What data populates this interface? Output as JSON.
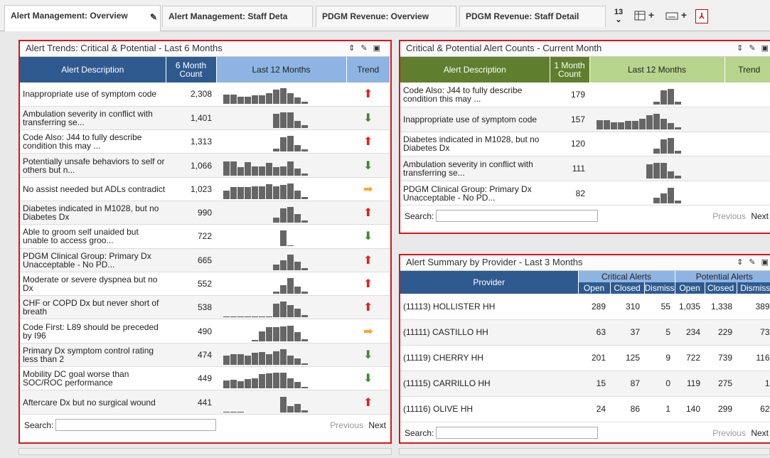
{
  "tabs": [
    {
      "label": "Alert Management: Overview",
      "active": true
    },
    {
      "label": "Alert Management: Staff Deta",
      "active": false
    },
    {
      "label": "PDGM Revenue: Overview",
      "active": false
    },
    {
      "label": "PDGM Revenue: Staff Detail",
      "active": false
    }
  ],
  "tab_count": "13",
  "tab_count_arrow": "⌄",
  "add_plus_1": "+",
  "add_plus_2": "+",
  "trends": {
    "title": "Alert Trends: Critical & Potential - Last 6 Months",
    "col_desc": "Alert Description",
    "col_count": "6 Month Count",
    "col_months": "Last 12 Months",
    "col_trend": "Trend",
    "rows": [
      {
        "desc": "Inappropriate use of symptom code",
        "count": "2,308",
        "trend": "up",
        "spark": [
          0.6,
          0.6,
          0.45,
          0.45,
          0.55,
          0.55,
          0.7,
          0.9,
          1.0,
          0.7,
          0.4,
          0.15
        ]
      },
      {
        "desc": "Ambulation severity in conflict with transferring se...",
        "count": "1,401",
        "trend": "down",
        "spark": [
          0,
          0,
          0,
          0,
          0,
          0,
          0,
          0.9,
          1.0,
          1.0,
          0.45,
          0.2
        ]
      },
      {
        "desc": "Code Also: J44 to fully describe condition this may ...",
        "count": "1,313",
        "trend": "up",
        "spark": [
          0,
          0,
          0,
          0,
          0,
          0,
          0,
          0.2,
          0.9,
          1.0,
          0.4,
          0.15
        ]
      },
      {
        "desc": "Potentially unsafe behaviors to self or others but n...",
        "count": "1,066",
        "trend": "down",
        "spark": [
          0.9,
          0.9,
          0.55,
          0.85,
          0.6,
          0.6,
          0.8,
          0.55,
          0.6,
          0.9,
          0.45,
          0.15
        ]
      },
      {
        "desc": "No assist needed but ADLs contradict",
        "count": "1,023",
        "trend": "side",
        "spark": [
          0.55,
          0.75,
          0.75,
          0.75,
          0.8,
          0.8,
          0.95,
          0.8,
          0.9,
          1.0,
          0.55,
          0.15
        ]
      },
      {
        "desc": "Diabetes indicated in M1028, but no Diabetes Dx",
        "count": "990",
        "trend": "up",
        "spark": [
          0,
          0,
          0,
          0,
          0,
          0,
          0,
          0.3,
          0.9,
          1.0,
          0.55,
          0.15
        ]
      },
      {
        "desc": "Able to groom self unaided but unable to access groo...",
        "count": "722",
        "trend": "down",
        "spark": [
          0,
          0,
          0,
          0,
          0,
          0,
          0,
          0,
          1.0,
          0.04,
          0,
          0
        ]
      },
      {
        "desc": "PDGM Clinical Group: Primary Dx Unacceptable - No PD...",
        "count": "665",
        "trend": "up",
        "spark": [
          0,
          0,
          0,
          0,
          0,
          0,
          0,
          0.35,
          0.65,
          1.0,
          0.55,
          0.15
        ]
      },
      {
        "desc": "Moderate or severe dyspnea but no Dx",
        "count": "552",
        "trend": "up",
        "spark": [
          0,
          0,
          0,
          0,
          0,
          0,
          0,
          0.15,
          0.55,
          1.0,
          0.45,
          0.15
        ]
      },
      {
        "desc": "CHF or COPD Dx but never short of breath",
        "count": "538",
        "trend": "up",
        "spark": [
          "l",
          "l",
          "l",
          "l",
          "l",
          "l",
          "l",
          0.85,
          1.0,
          0.75,
          0.55,
          0.15
        ]
      },
      {
        "desc": "Code First: L89 should be preceded by I96",
        "count": "490",
        "trend": "side",
        "spark": [
          0,
          0,
          0,
          0,
          0.1,
          0.65,
          0.9,
          0.9,
          0.95,
          1.0,
          0.6,
          0.15
        ]
      },
      {
        "desc": "Primary Dx symptom control rating less than 2",
        "count": "474",
        "trend": "down",
        "spark": [
          0.6,
          0.7,
          0.7,
          0.6,
          0.75,
          0.8,
          0.7,
          0.85,
          1.0,
          0.6,
          0.4,
          0.1
        ]
      },
      {
        "desc": "Mobility DC goal worse than SOC/ROC performance",
        "count": "449",
        "trend": "down",
        "spark": [
          0.5,
          0.55,
          0.45,
          0.6,
          0.65,
          0.9,
          0.95,
          1.0,
          1.0,
          0.65,
          0.4,
          0.1
        ]
      },
      {
        "desc": "Aftercare Dx but no surgical wound",
        "count": "441",
        "trend": "up",
        "spark": [
          "l",
          "l",
          "l",
          0,
          0,
          0,
          0,
          0,
          1.0,
          0.4,
          0.55,
          0.15
        ]
      }
    ],
    "search_label": "Search:",
    "prev": "Previous",
    "next": "Next"
  },
  "counts": {
    "title": "Critical & Potential Alert Counts - Current Month",
    "col_desc": "Alert Description",
    "col_count": "1 Month Count",
    "col_months": "Last 12 Months",
    "col_trend": "Trend",
    "rows": [
      {
        "desc": "Code Also: J44 to fully describe condition this may ...",
        "count": "179",
        "spark": [
          0,
          0,
          0,
          0,
          0,
          0,
          0,
          0,
          0.2,
          0.9,
          1.0,
          0.2
        ]
      },
      {
        "desc": "Inappropriate use of symptom code",
        "count": "157",
        "spark": [
          0.6,
          0.6,
          0.45,
          0.45,
          0.55,
          0.55,
          0.7,
          0.9,
          1.0,
          0.7,
          0.4,
          0.15
        ]
      },
      {
        "desc": "Diabetes indicated in M1028, but no Diabetes Dx",
        "count": "120",
        "spark": [
          0,
          0,
          0,
          0,
          0,
          0,
          0,
          0,
          0.3,
          0.9,
          1.0,
          0.2
        ]
      },
      {
        "desc": "Ambulation severity in conflict with transferring se...",
        "count": "111",
        "spark": [
          0,
          0,
          0,
          0,
          0,
          0,
          0,
          0.9,
          1.0,
          1.0,
          0.45,
          0.2
        ]
      },
      {
        "desc": "PDGM Clinical Group: Primary Dx Unacceptable - No PD...",
        "count": "82",
        "spark": [
          0,
          0,
          0,
          0,
          0,
          0,
          0,
          0,
          0.35,
          0.65,
          1.0,
          0.2
        ]
      }
    ],
    "search_label": "Search:",
    "prev": "Previous",
    "next": "Next"
  },
  "providers": {
    "title": "Alert Summary by Provider - Last 3 Months",
    "col_provider": "Provider",
    "group_critical": "Critical Alerts",
    "group_potential": "Potential Alerts",
    "sub_open": "Open",
    "sub_closed": "Closed",
    "sub_dismiss": "Dismiss",
    "sub_dismiss2": "Dismiss",
    "rows": [
      {
        "name": "(11113) HOLLISTER HH",
        "c_open": "289",
        "c_closed": "310",
        "c_dismiss": "55",
        "p_open": "1,035",
        "p_closed": "1,338",
        "p_dismiss": "389"
      },
      {
        "name": "(11111) CASTILLO HH",
        "c_open": "63",
        "c_closed": "37",
        "c_dismiss": "5",
        "p_open": "234",
        "p_closed": "229",
        "p_dismiss": "73"
      },
      {
        "name": "(11119) CHERRY HH",
        "c_open": "201",
        "c_closed": "125",
        "c_dismiss": "9",
        "p_open": "722",
        "p_closed": "739",
        "p_dismiss": "116"
      },
      {
        "name": "(11115) CARRILLO HH",
        "c_open": "15",
        "c_closed": "87",
        "c_dismiss": "0",
        "p_open": "119",
        "p_closed": "275",
        "p_dismiss": "1"
      },
      {
        "name": "(11116) OLIVE HH",
        "c_open": "24",
        "c_closed": "86",
        "c_dismiss": "1",
        "p_open": "140",
        "p_closed": "299",
        "p_dismiss": "62"
      }
    ],
    "search_label": "Search:",
    "prev": "Previous",
    "next": "Next"
  },
  "colors": {
    "trends_header": "#2f5a8f",
    "trends_months_header": "#8db4e2",
    "counts_header": "#5f7f2e",
    "counts_months_header": "#b7d48c",
    "providers_header": "#2f5a8f",
    "providers_sub_header": "#8db4e2",
    "border_highlight": "#d9141c"
  }
}
